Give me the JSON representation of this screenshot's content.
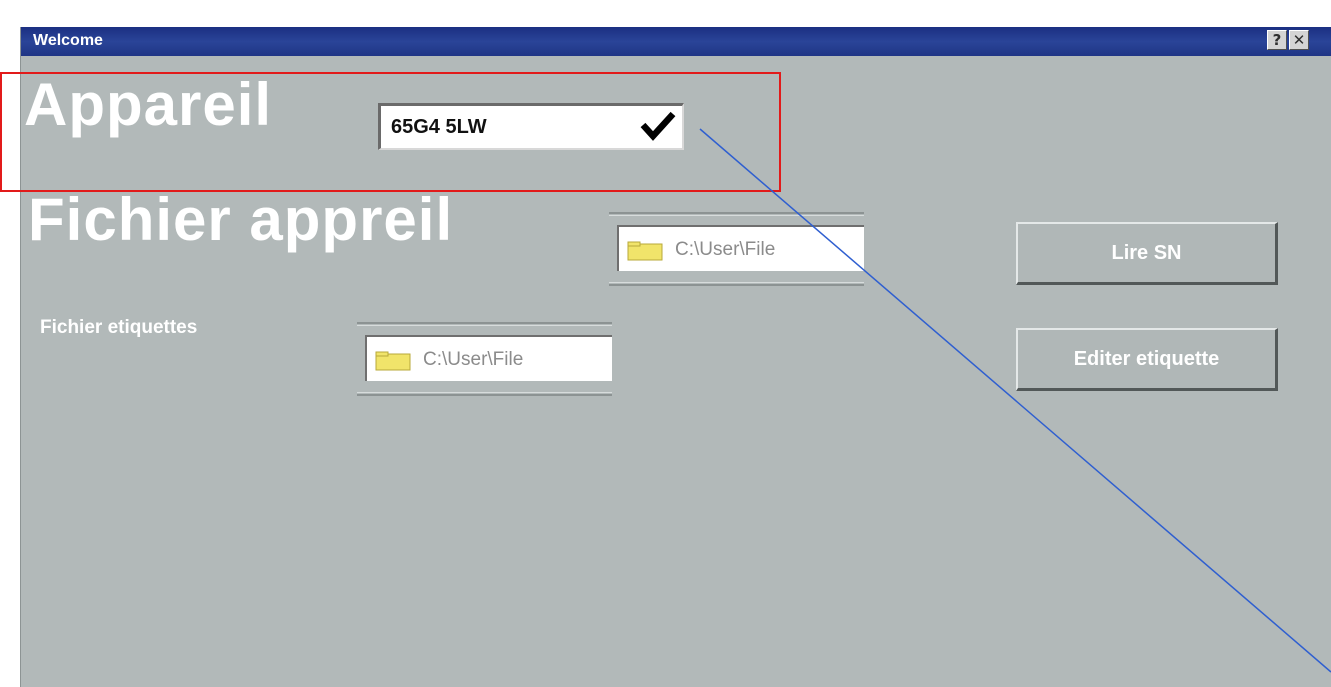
{
  "window": {
    "title": "Welcome",
    "help_button": "?",
    "close_button": "✕"
  },
  "device": {
    "label": "Appareil",
    "selected_value": "65G4 5LW",
    "dropdown_icon": "check-icon"
  },
  "device_file": {
    "label": "Fichier appreil",
    "path": "C:\\User\\File",
    "icon": "folder-icon"
  },
  "labels_file": {
    "label": "Fichier etiquettes",
    "path": "C:\\User\\File",
    "icon": "folder-icon"
  },
  "buttons": {
    "read_sn": "Lire SN",
    "edit_label": "Editer etiquette"
  },
  "colors": {
    "titlebar": "#233b8c",
    "window_background": "#b2b9b9",
    "highlight_box": "#e21a1a",
    "annotation_line": "#2f5fd0",
    "folder": "#f1e46a"
  }
}
